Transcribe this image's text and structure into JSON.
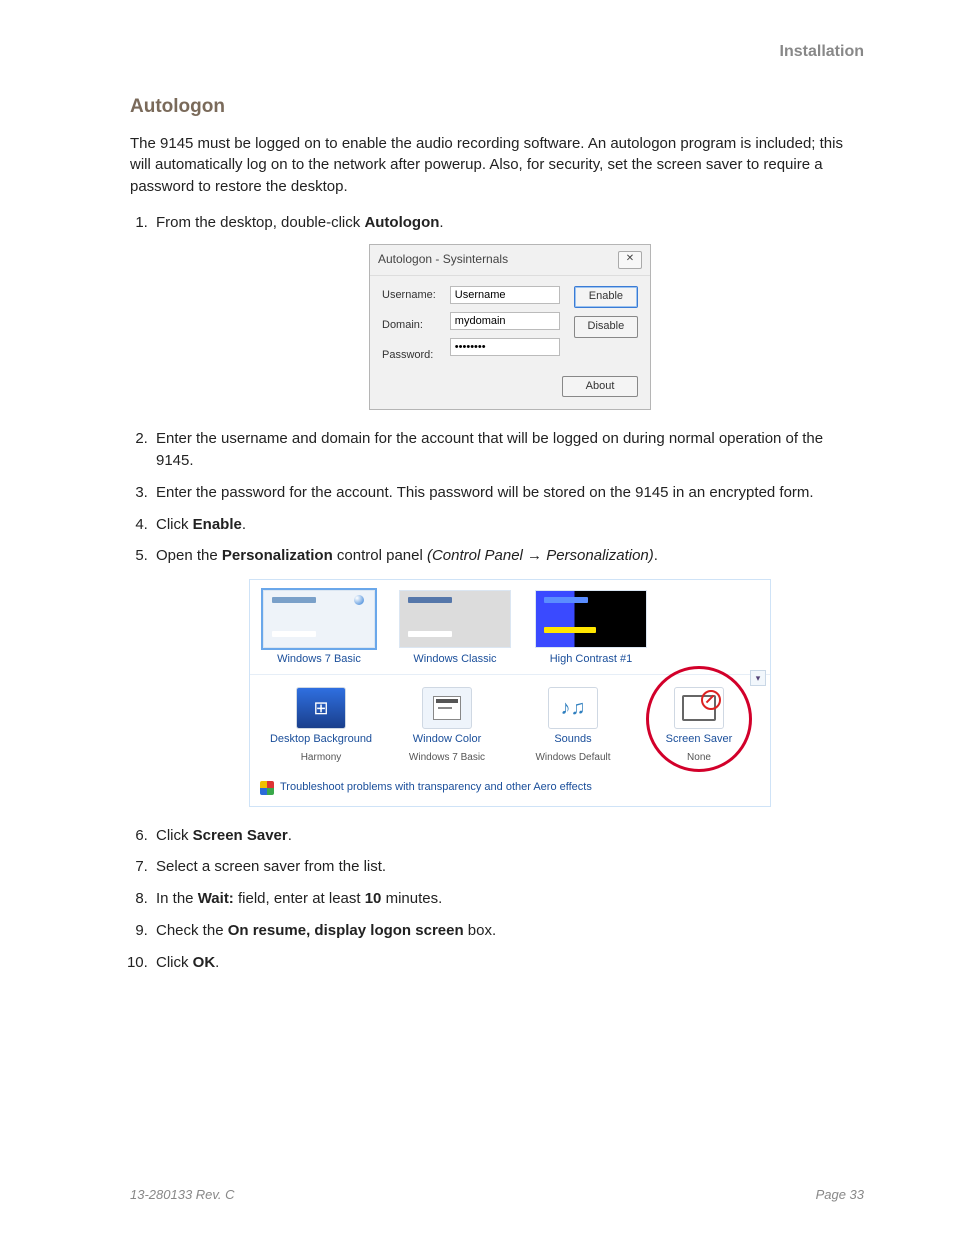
{
  "header": {
    "section": "Installation"
  },
  "title": "Autologon",
  "intro": "The 9145 must be logged on to enable the audio recording software. An autologon program is included; this will automatically log on to the network after powerup. Also, for security, set the screen saver to require a password to restore the desktop.",
  "steps": {
    "s1a": "From the desktop, double-click ",
    "s1b": "Autologon",
    "s1c": ".",
    "s2": "Enter the username and domain for the account that will be logged on during normal operation of the 9145.",
    "s3": "Enter the password for the account. This password will be stored on the 9145 in an encrypted form.",
    "s4a": "Click ",
    "s4b": "Enable",
    "s4c": ".",
    "s5a": "Open the ",
    "s5b": "Personalization",
    "s5c": " control panel ",
    "s5d": "(Control Panel → Personalization)",
    "s5e": ".",
    "s6a": "Click ",
    "s6b": "Screen Saver",
    "s6c": ".",
    "s7": "Select a screen saver from the list.",
    "s8a": "In the ",
    "s8b": "Wait:",
    "s8c": " field, enter at least ",
    "s8d": "10",
    "s8e": " minutes.",
    "s9a": "Check the ",
    "s9b": "On resume, display logon screen",
    "s9c": " box.",
    "s10a": "Click ",
    "s10b": "OK",
    "s10c": "."
  },
  "dialog": {
    "title": "Autologon - Sysinternals",
    "close": "✕",
    "labels": {
      "user": "Username:",
      "domain": "Domain:",
      "pass": "Password:"
    },
    "values": {
      "user": "Username",
      "domain": "mydomain",
      "pass": "••••••••"
    },
    "buttons": {
      "enable": "Enable",
      "disable": "Disable",
      "about": "About"
    }
  },
  "panel": {
    "themes": {
      "win7": "Windows 7 Basic",
      "classic": "Windows Classic",
      "hc": "High Contrast #1"
    },
    "options": {
      "desktop": {
        "title": "Desktop Background",
        "sub": "Harmony"
      },
      "color": {
        "title": "Window Color",
        "sub": "Windows 7 Basic"
      },
      "sounds": {
        "title": "Sounds",
        "sub": "Windows Default"
      },
      "ss": {
        "title": "Screen Saver",
        "sub": "None"
      }
    },
    "troubleshoot": "Troubleshoot problems with transparency and other Aero effects",
    "scroll": "▾"
  },
  "footer": {
    "left": "13-280133  Rev. C",
    "right": "Page 33"
  }
}
